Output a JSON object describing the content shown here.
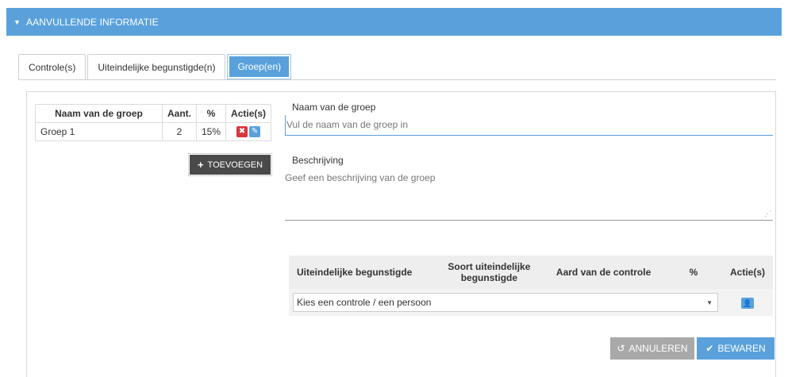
{
  "section": {
    "title": "AANVULLENDE INFORMATIE",
    "caret_icon": "caret-down-icon"
  },
  "tabs": [
    {
      "label": "Controle(s)"
    },
    {
      "label": "Uiteindelijke begunstigde(n)"
    },
    {
      "label": "Groep(en)",
      "active": true
    }
  ],
  "groups_table": {
    "headers": [
      "Naam van de groep",
      "Aant.",
      "%",
      "Actie(s)"
    ],
    "rows": [
      {
        "name": "Groep 1",
        "count": "2",
        "percent": "15%"
      }
    ]
  },
  "add_button": {
    "label": "TOEVOEGEN",
    "icon": "plus-icon"
  },
  "form": {
    "name_label": "Naam van de groep",
    "name_placeholder": "Vul de naam van de groep in",
    "description_label": "Beschrijving",
    "description_placeholder": "Geef een beschrijving van de groep"
  },
  "beneficiary_table": {
    "headers": [
      "Uiteindelijke begunstigde",
      "Soort uiteindelijke begunstigde",
      "Aard van de controle",
      "%",
      "Actie(s)"
    ],
    "select_value": "Kies een controle / een persoon"
  },
  "buttons": {
    "cancel": "ANNULEREN",
    "save": "BEWAREN"
  },
  "colors": {
    "accent": "#5aa1dc",
    "danger": "#d9363e",
    "dark_button": "#4a4a4a",
    "muted_button": "#a9a9a9"
  }
}
